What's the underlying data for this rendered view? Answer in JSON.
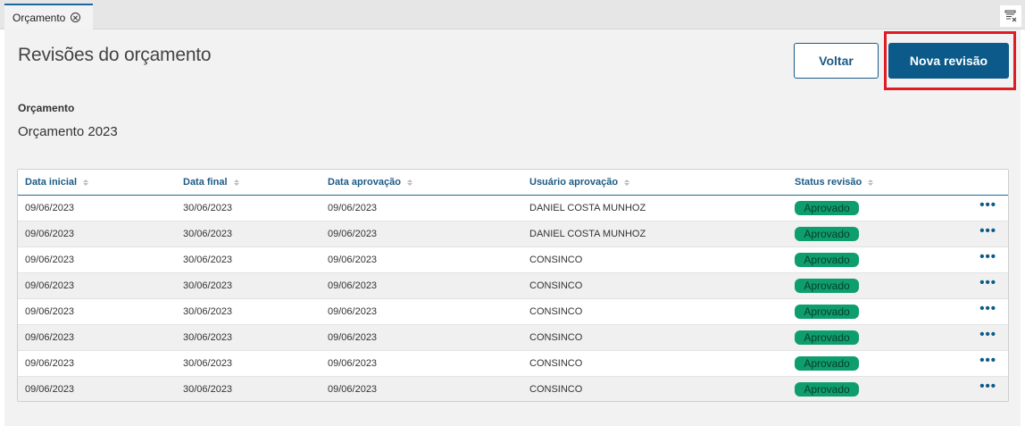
{
  "tab": {
    "label": "Orçamento"
  },
  "page": {
    "title": "Revisões do orçamento"
  },
  "actions": {
    "back_label": "Voltar",
    "new_revision_label": "Nova revisão"
  },
  "field": {
    "label": "Orçamento",
    "value": "Orçamento 2023"
  },
  "table": {
    "columns": [
      "Data inicial",
      "Data final",
      "Data aprovação",
      "Usuário aprovação",
      "Status revisão"
    ],
    "rows": [
      [
        "09/06/2023",
        "30/06/2023",
        "09/06/2023",
        "DANIEL COSTA MUNHOZ",
        "Aprovado"
      ],
      [
        "09/06/2023",
        "30/06/2023",
        "09/06/2023",
        "DANIEL COSTA MUNHOZ",
        "Aprovado"
      ],
      [
        "09/06/2023",
        "30/06/2023",
        "09/06/2023",
        "CONSINCO",
        "Aprovado"
      ],
      [
        "09/06/2023",
        "30/06/2023",
        "09/06/2023",
        "CONSINCO",
        "Aprovado"
      ],
      [
        "09/06/2023",
        "30/06/2023",
        "09/06/2023",
        "CONSINCO",
        "Aprovado"
      ],
      [
        "09/06/2023",
        "30/06/2023",
        "09/06/2023",
        "CONSINCO",
        "Aprovado"
      ],
      [
        "09/06/2023",
        "30/06/2023",
        "09/06/2023",
        "CONSINCO",
        "Aprovado"
      ],
      [
        "09/06/2023",
        "30/06/2023",
        "09/06/2023",
        "CONSINCO",
        "Aprovado"
      ]
    ],
    "row_menu_icon": "more-horizontal-icon"
  },
  "colors": {
    "primary": "#0b5a8a",
    "status_approved": "#0e9e6e",
    "highlight": "#e01b24"
  }
}
